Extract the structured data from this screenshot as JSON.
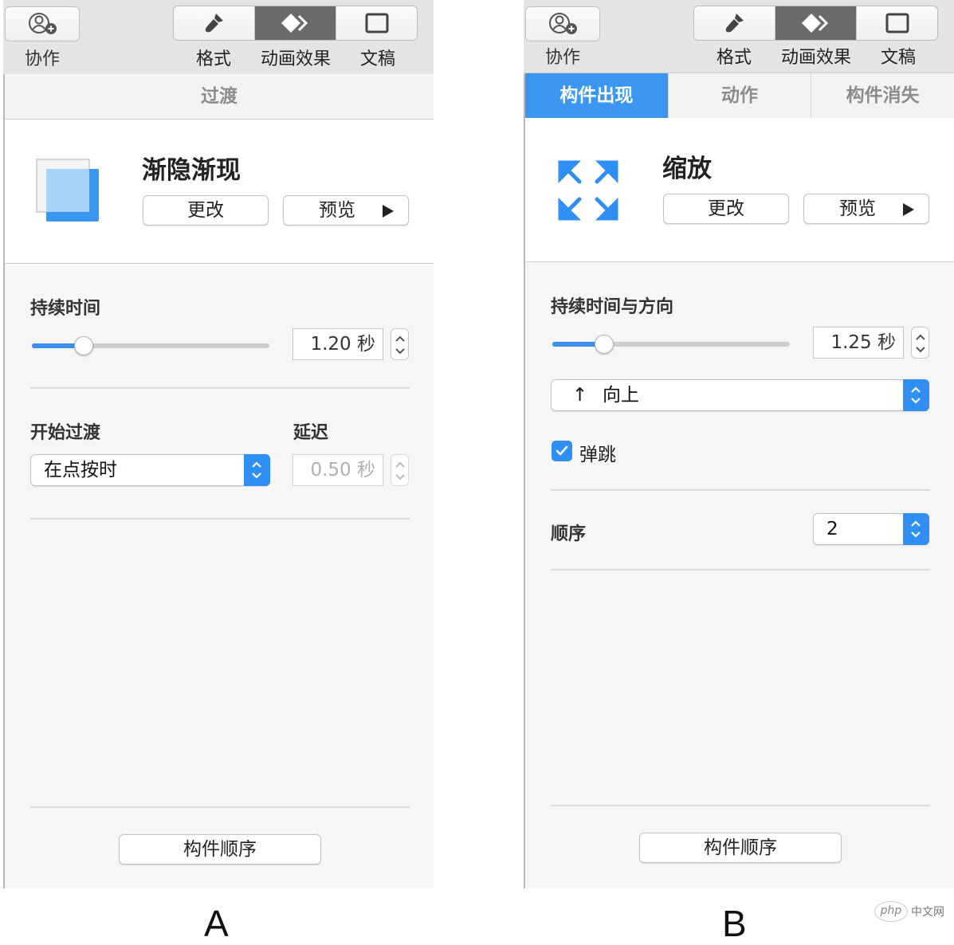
{
  "panel_a": {
    "toolbar": {
      "collab_label": "协作",
      "tabs": [
        {
          "label": "格式",
          "icon": "paintbrush-icon",
          "active": false
        },
        {
          "label": "动画效果",
          "icon": "animate-diamond-icon",
          "active": true
        },
        {
          "label": "文稿",
          "icon": "document-icon",
          "active": false
        }
      ]
    },
    "section_header": "过渡",
    "effect": {
      "name": "渐隐渐现",
      "icon": "dissolve-squares-icon",
      "change_label": "更改",
      "preview_label": "预览"
    },
    "duration": {
      "label": "持续时间",
      "value": "1.20 秒",
      "slider_fraction": 0.22
    },
    "start_transition": {
      "label": "开始过渡",
      "selected": "在点按时"
    },
    "delay": {
      "label": "延迟",
      "value": "0.50 秒",
      "disabled": true
    },
    "order_button": "构件顺序",
    "caption": "A"
  },
  "panel_b": {
    "toolbar": {
      "collab_label": "协作",
      "tabs": [
        {
          "label": "格式",
          "icon": "paintbrush-icon",
          "active": false
        },
        {
          "label": "动画效果",
          "icon": "animate-diamond-icon",
          "active": true
        },
        {
          "label": "文稿",
          "icon": "document-icon",
          "active": false
        }
      ]
    },
    "tabs": [
      {
        "label": "构件出现",
        "active": true
      },
      {
        "label": "动作",
        "active": false
      },
      {
        "label": "构件消失",
        "active": false
      }
    ],
    "effect": {
      "name": "缩放",
      "icon": "zoom-arrows-icon",
      "change_label": "更改",
      "preview_label": "预览"
    },
    "duration": {
      "label": "持续时间与方向",
      "value": "1.25 秒",
      "slider_fraction": 0.22
    },
    "direction": {
      "arrow": "↑",
      "selected": "向上"
    },
    "bounce": {
      "label": "弹跳",
      "checked": true
    },
    "order": {
      "label": "顺序",
      "value": "2"
    },
    "order_button": "构件顺序",
    "caption": "B"
  },
  "watermark": {
    "logo": "php",
    "text": "中文网"
  },
  "colors": {
    "accent": "#2f8ff4",
    "tab_active": "#3b96f1",
    "toolbar_active": "#6a6a6a"
  }
}
